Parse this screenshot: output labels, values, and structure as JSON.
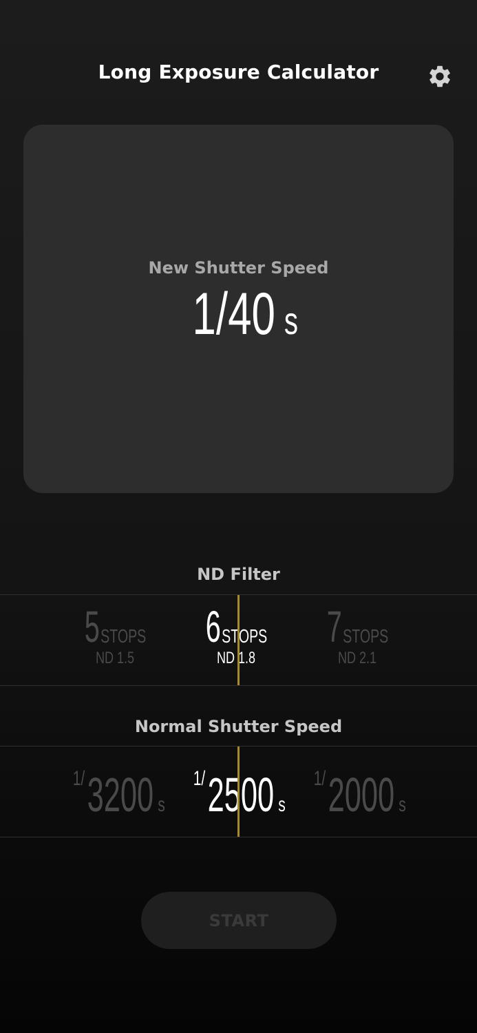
{
  "header": {
    "title": "Long Exposure Calculator",
    "settings_icon": "gear-icon"
  },
  "result": {
    "label": "New Shutter Speed",
    "value": "1/40",
    "unit": "s"
  },
  "nd_filter": {
    "label": "ND Filter",
    "options": [
      {
        "stops": "5",
        "stops_label": "STOPS",
        "nd": "ND 1.5"
      },
      {
        "stops": "6",
        "stops_label": "STOPS",
        "nd": "ND 1.8"
      },
      {
        "stops": "7",
        "stops_label": "STOPS",
        "nd": "ND 2.1"
      }
    ],
    "selected_index": 1
  },
  "normal_shutter": {
    "label": "Normal Shutter Speed",
    "options": [
      {
        "numerator": "1/",
        "denominator": "3200",
        "unit": "s"
      },
      {
        "numerator": "1/",
        "denominator": "2500",
        "unit": "s"
      },
      {
        "numerator": "1/",
        "denominator": "2000",
        "unit": "s"
      }
    ],
    "selected_index": 1
  },
  "start_button": {
    "label": "START"
  },
  "colors": {
    "indicator": "#a88a2c",
    "card": "#2d2d2d",
    "dim_text": "#4a4a4a"
  }
}
